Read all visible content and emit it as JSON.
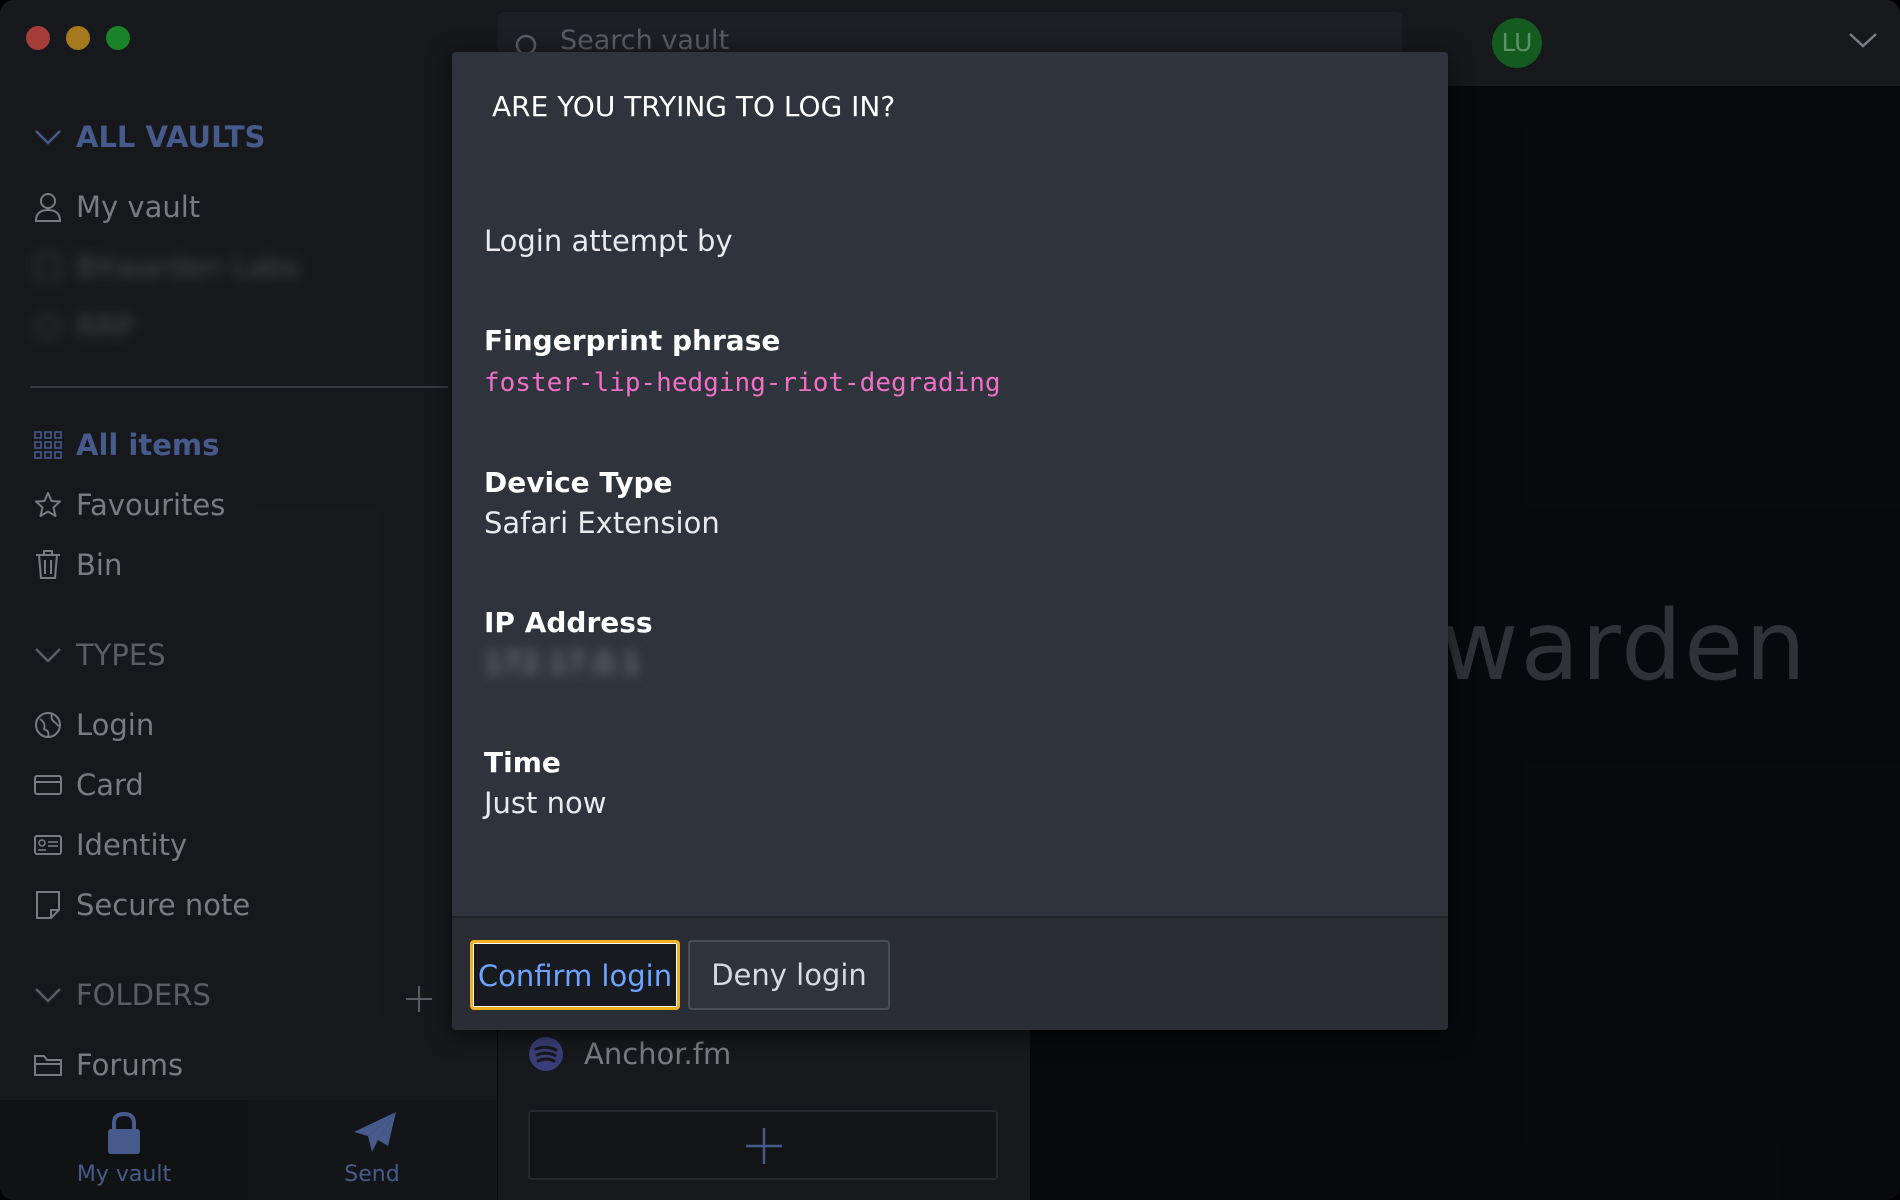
{
  "window": {
    "search_placeholder": "Search vault",
    "avatar_initials": "LU",
    "brand_text": "warden"
  },
  "sidebar": {
    "all_vaults": "ALL VAULTS",
    "vaults": [
      {
        "label": "My vault"
      },
      {
        "label": "Bitwarden Labs"
      },
      {
        "label": "RRP"
      }
    ],
    "all_items": "All items",
    "favourites": "Favourites",
    "bin": "Bin",
    "types_heading": "TYPES",
    "types": [
      {
        "label": "Login"
      },
      {
        "label": "Card"
      },
      {
        "label": "Identity"
      },
      {
        "label": "Secure note"
      }
    ],
    "folders_heading": "FOLDERS",
    "folders": [
      {
        "label": "Forums"
      }
    ]
  },
  "bottom_nav": {
    "my_vault": "My vault",
    "send": "Send"
  },
  "list": {
    "item_name": "Anchor.fm"
  },
  "modal": {
    "title": "ARE YOU TRYING TO LOG IN?",
    "login_attempt_by": "Login attempt by",
    "fingerprint_label": "Fingerprint phrase",
    "fingerprint_value": "foster-lip-hedging-riot-degrading",
    "device_type_label": "Device Type",
    "device_type_value": "Safari Extension",
    "ip_label": "IP Address",
    "ip_value": "172.17.0.1",
    "time_label": "Time",
    "time_value": "Just now",
    "confirm_button": "Confirm login",
    "deny_button": "Deny login"
  },
  "colors": {
    "accent": "#6c8bd8",
    "fingerprint": "#f06fc7",
    "focus_ring": "#f0b021",
    "avatar": "#1e8d2e"
  }
}
